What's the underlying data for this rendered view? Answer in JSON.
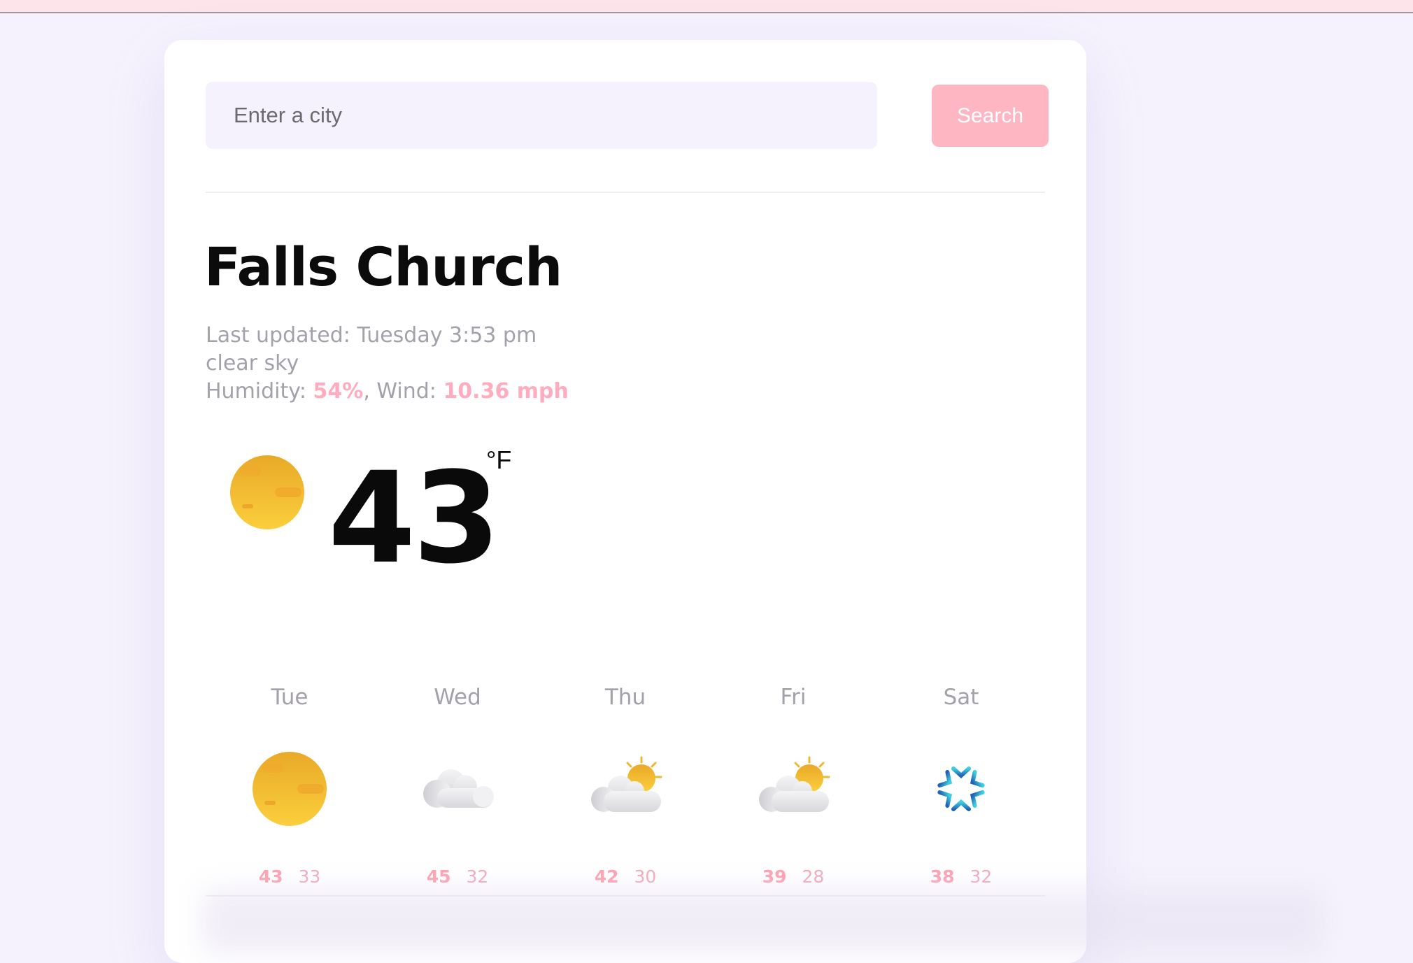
{
  "search": {
    "placeholder": "Enter a city",
    "value": "",
    "button_label": "Search"
  },
  "current": {
    "city": "Falls Church",
    "updated_label": "Last updated:",
    "updated_value": "Tuesday 3:53 pm",
    "description": "clear sky",
    "humidity_label": "Humidity:",
    "humidity_value": "54%",
    "wind_label": ", Wind:",
    "wind_value": "10.36 mph",
    "temperature": "43",
    "unit": "°F",
    "icon": "sun-icon"
  },
  "forecast": [
    {
      "day": "Tue",
      "icon": "sun-icon",
      "high": "43",
      "low": "33"
    },
    {
      "day": "Wed",
      "icon": "cloud-icon",
      "high": "45",
      "low": "32"
    },
    {
      "day": "Thu",
      "icon": "partly-cloudy-icon",
      "high": "42",
      "low": "30"
    },
    {
      "day": "Fri",
      "icon": "partly-cloudy-icon",
      "high": "39",
      "low": "28"
    },
    {
      "day": "Sat",
      "icon": "snowflake-icon",
      "high": "38",
      "low": "32"
    }
  ],
  "colors": {
    "accent": "#ffb6c3",
    "highlight": "#ffadbe",
    "muted_text": "#a4a1ab",
    "page_background": "#f5f2fd",
    "top_bar": "#fde4ea"
  }
}
